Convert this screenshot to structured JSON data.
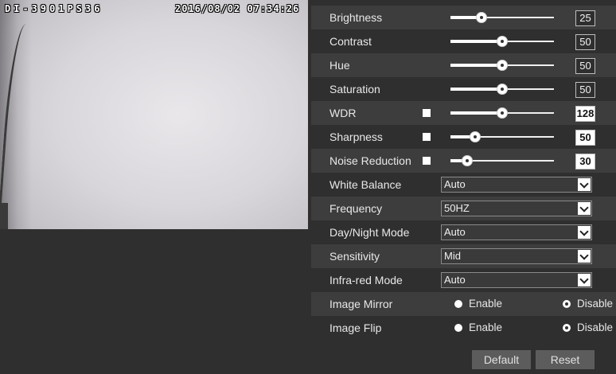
{
  "video": {
    "osd_name": "DI-3901PS36",
    "osd_time": "2016/08/02 07:34:26"
  },
  "sliders": [
    {
      "label": "Brightness",
      "value": "25",
      "level": 0.3,
      "checkbox": false,
      "value_style": "outline"
    },
    {
      "label": "Contrast",
      "value": "50",
      "level": 0.5,
      "checkbox": false,
      "value_style": "outline"
    },
    {
      "label": "Hue",
      "value": "50",
      "level": 0.5,
      "checkbox": false,
      "value_style": "outline"
    },
    {
      "label": "Saturation",
      "value": "50",
      "level": 0.5,
      "checkbox": false,
      "value_style": "outline"
    },
    {
      "label": "WDR",
      "value": "128",
      "level": 0.5,
      "checkbox": true,
      "value_style": "filled"
    },
    {
      "label": "Sharpness",
      "value": "50",
      "level": 0.24,
      "checkbox": true,
      "value_style": "filled"
    },
    {
      "label": "Noise Reduction",
      "value": "30",
      "level": 0.16,
      "checkbox": true,
      "value_style": "filled"
    }
  ],
  "selects": [
    {
      "label": "White Balance",
      "value": "Auto"
    },
    {
      "label": "Frequency",
      "value": "50HZ"
    },
    {
      "label": "Day/Night Mode",
      "value": "Auto"
    },
    {
      "label": "Sensitivity",
      "value": "Mid"
    },
    {
      "label": "Infra-red Mode",
      "value": "Auto"
    }
  ],
  "radios": [
    {
      "label": "Image Mirror",
      "options": [
        "Enable",
        "Disable"
      ],
      "selected": "Disable"
    },
    {
      "label": "Image Flip",
      "options": [
        "Enable",
        "Disable"
      ],
      "selected": "Disable"
    }
  ],
  "buttons": {
    "default_label": "Default",
    "reset_label": "Reset"
  },
  "colors": {
    "background": "#2f2f2f",
    "row_shade": "#3d3d3d",
    "button": "#5c5c5c"
  }
}
